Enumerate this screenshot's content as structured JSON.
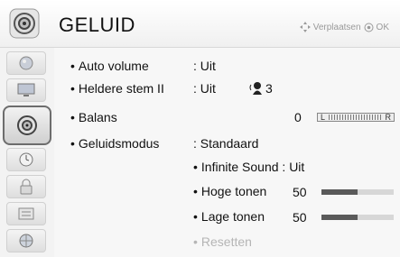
{
  "header": {
    "title": "GELUID",
    "hint_move": "Verplaatsen",
    "hint_ok": "OK"
  },
  "sidebar": {
    "items": [
      {
        "icon": "picture-icon"
      },
      {
        "icon": "screen-icon"
      },
      {
        "icon": "sound-icon",
        "active": true
      },
      {
        "icon": "clock-icon"
      },
      {
        "icon": "lock-icon"
      },
      {
        "icon": "options-icon"
      },
      {
        "icon": "network-icon"
      }
    ]
  },
  "settings": {
    "auto_volume": {
      "label": "Auto volume",
      "value": ": Uit"
    },
    "clear_voice": {
      "label": "Heldere stem II",
      "value": ": Uit",
      "level": "3"
    },
    "balance": {
      "label": "Balans",
      "value": "0",
      "left": "L",
      "right": "R"
    },
    "sound_mode": {
      "label": "Geluidsmodus",
      "value": ": Standaard"
    },
    "infinite_sound": {
      "label": "Infinite Sound : Uit"
    },
    "treble": {
      "label": "Hoge tonen",
      "value": "50",
      "level": 0.5
    },
    "bass": {
      "label": "Lage tonen",
      "value": "50",
      "level": 0.5
    },
    "reset": {
      "label": "Resetten"
    }
  },
  "colors": {
    "accent": "#5a5a5a",
    "bar_track": "#d7d7d7",
    "disabled_text": "#b5b5b5"
  }
}
